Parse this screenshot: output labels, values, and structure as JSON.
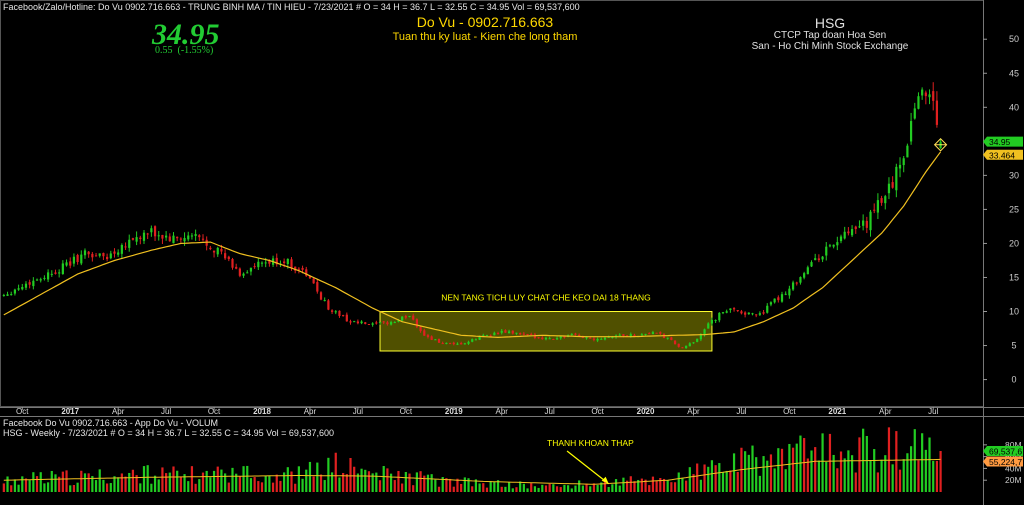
{
  "header": {
    "top_line": "Facebook/Zalo/Hotline: Do Vu 0902.716.663 - TRUNG BINH MA / TIN HIEU  - 7/23/2021  #  O = 34  H = 36.7  L = 32.55  C = 34.95  Vol = 69,537,600",
    "price": "34.95",
    "change": "0.55  (-1.55%)",
    "author": "Do Vu - 0902.716.663",
    "slogan": "Tuan thu ky luat - Kiem che long tham",
    "ticker": "HSG",
    "company": "CTCP Tap doan Hoa Sen",
    "exchange": "San - Ho Chi Minh Stock Exchange"
  },
  "volume_header": {
    "line1": "Facebook Do Vu 0902.716.663 - App Do Vu - VOLUM",
    "line2": "HSG - Weekly  - 7/23/2021  #  O = 34  H = 36.7  L = 32.55  C = 34.95  Vol = 69,537,600"
  },
  "colors": {
    "up": "#22cc22",
    "down": "#e02020",
    "ma": "#f0c020",
    "box_fill": "#6b6b00",
    "box_stroke": "#ffff30",
    "annotation": "#ffff00",
    "badge_price": "#22cc22",
    "badge_ma": "#f0c020",
    "badge_vol": "#ff9a40"
  },
  "chart_data": [
    {
      "type": "candlestick",
      "title": "HSG",
      "interval": "weekly",
      "ylim": [
        -3,
        54
      ],
      "yticks": [
        0,
        5,
        10,
        15,
        20,
        25,
        30,
        35,
        40,
        45,
        50
      ],
      "x_tick_labels": [
        "Oct",
        "2017",
        "Apr",
        "Jul",
        "Oct",
        "2018",
        "Apr",
        "Jul",
        "Oct",
        "2019",
        "Apr",
        "Jul",
        "Oct",
        "2020",
        "Apr",
        "Jul",
        "Oct",
        "2021",
        "Apr",
        "Jul"
      ],
      "x_tick_weeks": [
        5,
        18,
        31,
        44,
        57,
        70,
        83,
        96,
        109,
        122,
        135,
        148,
        161,
        174,
        187,
        200,
        213,
        226,
        239,
        252
      ],
      "close_series": [
        {
          "week": 0,
          "close": 12.5
        },
        {
          "week": 6,
          "close": 14.0
        },
        {
          "week": 10,
          "close": 15.0
        },
        {
          "week": 16,
          "close": 16.5
        },
        {
          "week": 22,
          "close": 18.5
        },
        {
          "week": 28,
          "close": 18.0
        },
        {
          "week": 34,
          "close": 20.5
        },
        {
          "week": 40,
          "close": 21.5
        },
        {
          "week": 46,
          "close": 20.5
        },
        {
          "week": 52,
          "close": 21.0
        },
        {
          "week": 58,
          "close": 19.0
        },
        {
          "week": 64,
          "close": 15.5
        },
        {
          "week": 70,
          "close": 17.0
        },
        {
          "week": 76,
          "close": 17.5
        },
        {
          "week": 82,
          "close": 15.5
        },
        {
          "week": 88,
          "close": 10.5
        },
        {
          "week": 94,
          "close": 8.5
        },
        {
          "week": 100,
          "close": 8.0
        },
        {
          "week": 106,
          "close": 8.5
        },
        {
          "week": 110,
          "close": 9.5
        },
        {
          "week": 114,
          "close": 6.5
        },
        {
          "week": 118,
          "close": 5.5
        },
        {
          "week": 122,
          "close": 5.0
        },
        {
          "week": 126,
          "close": 5.5
        },
        {
          "week": 130,
          "close": 6.5
        },
        {
          "week": 136,
          "close": 7.0
        },
        {
          "week": 142,
          "close": 6.5
        },
        {
          "week": 148,
          "close": 6.0
        },
        {
          "week": 154,
          "close": 6.5
        },
        {
          "week": 160,
          "close": 6.0
        },
        {
          "week": 166,
          "close": 6.5
        },
        {
          "week": 172,
          "close": 6.5
        },
        {
          "week": 176,
          "close": 7.0
        },
        {
          "week": 180,
          "close": 6.0
        },
        {
          "week": 184,
          "close": 4.5
        },
        {
          "week": 187,
          "close": 5.5
        },
        {
          "week": 190,
          "close": 7.5
        },
        {
          "week": 194,
          "close": 9.5
        },
        {
          "week": 198,
          "close": 10.5
        },
        {
          "week": 202,
          "close": 9.5
        },
        {
          "week": 206,
          "close": 10.0
        },
        {
          "week": 210,
          "close": 12.0
        },
        {
          "week": 214,
          "close": 14.0
        },
        {
          "week": 218,
          "close": 16.5
        },
        {
          "week": 222,
          "close": 18.5
        },
        {
          "week": 226,
          "close": 20.5
        },
        {
          "week": 230,
          "close": 21.5
        },
        {
          "week": 234,
          "close": 23.0
        },
        {
          "week": 238,
          "close": 26.5
        },
        {
          "week": 241,
          "close": 29.0
        },
        {
          "week": 244,
          "close": 33.0
        },
        {
          "week": 246,
          "close": 38.0
        },
        {
          "week": 248,
          "close": 42.0
        },
        {
          "week": 250,
          "close": 42.5
        },
        {
          "week": 252,
          "close": 41.0
        },
        {
          "week": 254,
          "close": 34.95
        }
      ],
      "ma_series": [
        {
          "week": 0,
          "value": 9.5
        },
        {
          "week": 10,
          "value": 12.5
        },
        {
          "week": 20,
          "value": 15.5
        },
        {
          "week": 30,
          "value": 17.5
        },
        {
          "week": 40,
          "value": 19.0
        },
        {
          "week": 48,
          "value": 20.0
        },
        {
          "week": 56,
          "value": 20.2
        },
        {
          "week": 64,
          "value": 18.5
        },
        {
          "week": 72,
          "value": 17.5
        },
        {
          "week": 80,
          "value": 16.0
        },
        {
          "week": 90,
          "value": 13.5
        },
        {
          "week": 100,
          "value": 10.5
        },
        {
          "week": 108,
          "value": 8.5
        },
        {
          "week": 116,
          "value": 7.5
        },
        {
          "week": 124,
          "value": 6.5
        },
        {
          "week": 134,
          "value": 6.2
        },
        {
          "week": 146,
          "value": 6.5
        },
        {
          "week": 158,
          "value": 6.3
        },
        {
          "week": 170,
          "value": 6.3
        },
        {
          "week": 182,
          "value": 6.5
        },
        {
          "week": 190,
          "value": 6.6
        },
        {
          "week": 198,
          "value": 7.0
        },
        {
          "week": 206,
          "value": 8.5
        },
        {
          "week": 214,
          "value": 10.5
        },
        {
          "week": 222,
          "value": 13.5
        },
        {
          "week": 230,
          "value": 17.5
        },
        {
          "week": 238,
          "value": 21.5
        },
        {
          "week": 244,
          "value": 25.5
        },
        {
          "week": 250,
          "value": 30.5
        },
        {
          "week": 254,
          "value": 33.464
        }
      ],
      "annotations": {
        "box": {
          "x_from": 102,
          "x_to": 192,
          "y_from": 4.2,
          "y_to": 10.0,
          "label": "NEN TANG TICH LUY CHAT CHE KEO DAI 18 THANG"
        }
      },
      "last_price_label": "34.95",
      "ma_last_label": "33.464"
    },
    {
      "type": "bar",
      "title": "VOLUM",
      "ylim": [
        0,
        95
      ],
      "yticks": [
        20,
        40,
        60,
        80
      ],
      "ytick_labels": [
        "20M",
        "40M",
        "60M",
        "80M"
      ],
      "volume_millions": [
        {
          "week": 0,
          "value": 22
        },
        {
          "week": 20,
          "value": 25
        },
        {
          "week": 40,
          "value": 30
        },
        {
          "week": 60,
          "value": 28
        },
        {
          "week": 80,
          "value": 30
        },
        {
          "week": 90,
          "value": 45
        },
        {
          "week": 100,
          "value": 32
        },
        {
          "week": 110,
          "value": 25
        },
        {
          "week": 120,
          "value": 18
        },
        {
          "week": 140,
          "value": 12
        },
        {
          "week": 150,
          "value": 10
        },
        {
          "week": 160,
          "value": 15
        },
        {
          "week": 175,
          "value": 20
        },
        {
          "week": 185,
          "value": 28
        },
        {
          "week": 195,
          "value": 45
        },
        {
          "week": 205,
          "value": 55
        },
        {
          "week": 215,
          "value": 62
        },
        {
          "week": 225,
          "value": 68
        },
        {
          "week": 235,
          "value": 72
        },
        {
          "week": 245,
          "value": 70
        },
        {
          "week": 254,
          "value": 69.54
        }
      ],
      "volume_ma_millions": [
        {
          "week": 0,
          "value": 20
        },
        {
          "week": 40,
          "value": 25
        },
        {
          "week": 80,
          "value": 28
        },
        {
          "week": 100,
          "value": 27
        },
        {
          "week": 130,
          "value": 18
        },
        {
          "week": 160,
          "value": 13
        },
        {
          "week": 180,
          "value": 20
        },
        {
          "week": 200,
          "value": 38
        },
        {
          "week": 220,
          "value": 52
        },
        {
          "week": 254,
          "value": 55.22
        }
      ],
      "annotation": "THANH KHOAN THAP",
      "last_volume_label": "69,537,6",
      "vol_ma_label": "55,224,7"
    }
  ]
}
